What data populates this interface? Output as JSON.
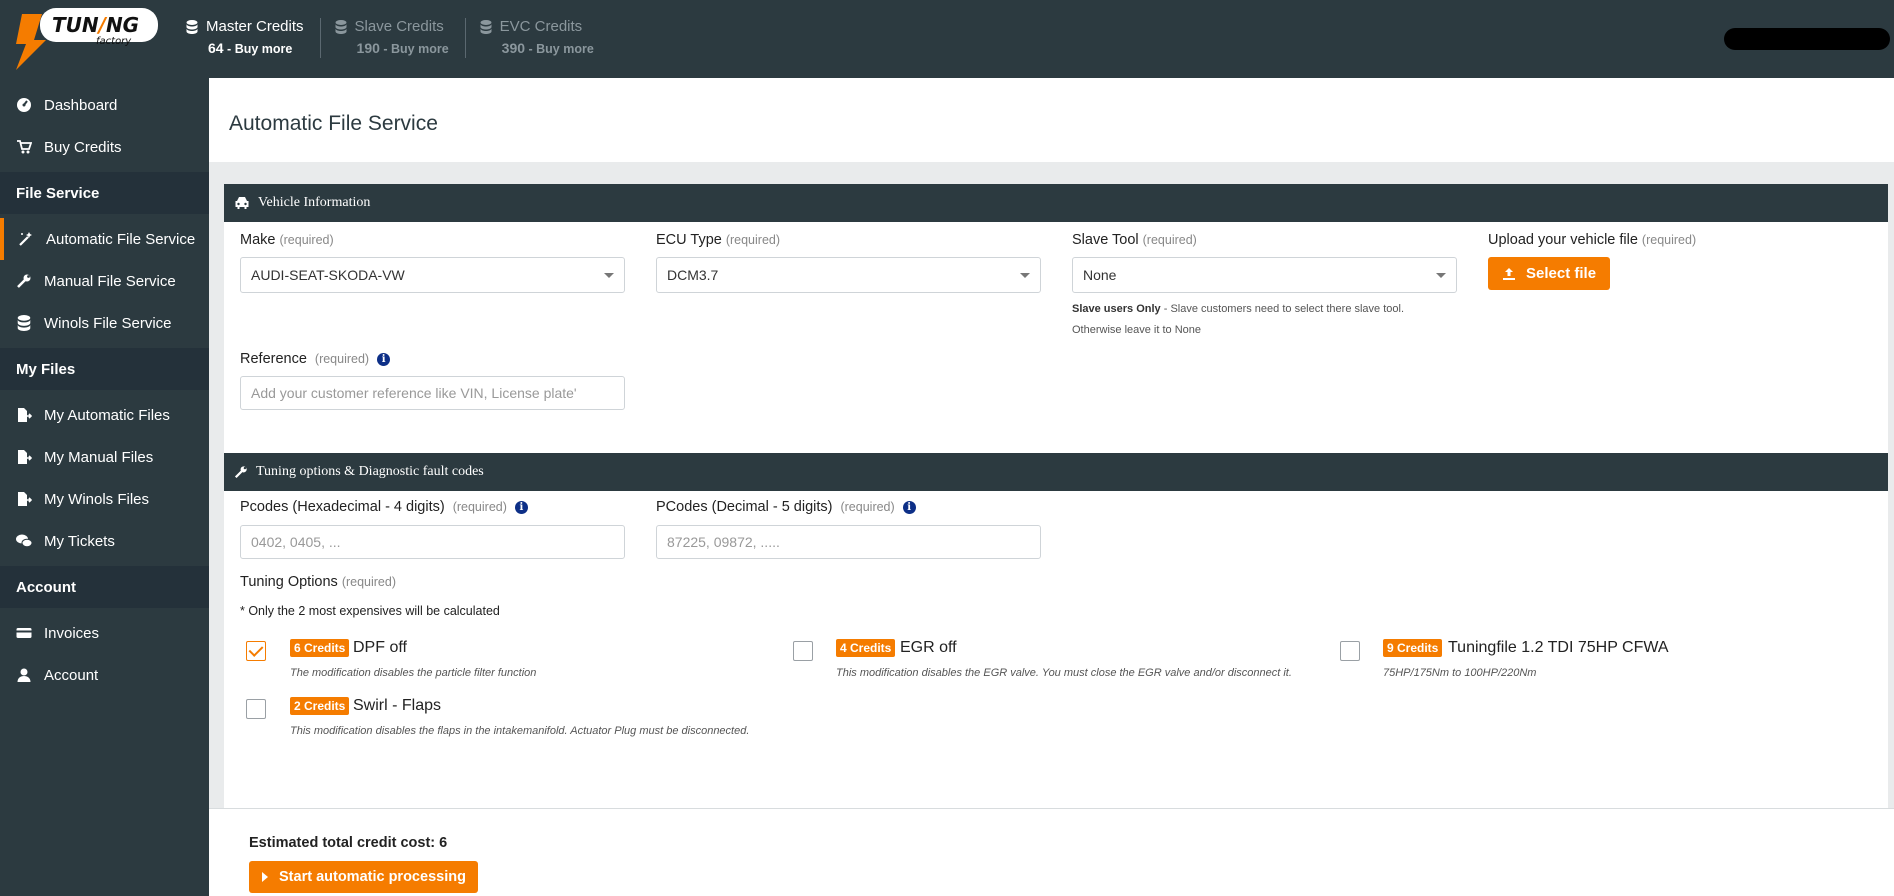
{
  "brand": {
    "logo_text_top": "TUNING",
    "logo_text_bottom": "factory",
    "accent": "#f57c00",
    "dark": "#2c3a40"
  },
  "credits": [
    {
      "title": "Master Credits",
      "amount": "64",
      "link": "Buy more",
      "dim": false
    },
    {
      "title": "Slave Credits",
      "amount": "190",
      "link": "Buy more",
      "dim": true
    },
    {
      "title": "EVC Credits",
      "amount": "390",
      "link": "Buy more",
      "dim": true
    }
  ],
  "sidebar": {
    "top": [
      {
        "label": "Dashboard",
        "icon": "gauge-icon"
      },
      {
        "label": "Buy Credits",
        "icon": "cart-icon"
      }
    ],
    "sections": [
      {
        "title": "File Service",
        "items": [
          {
            "label": "Automatic File Service",
            "icon": "magic-wand-icon",
            "active": true
          },
          {
            "label": "Manual File Service",
            "icon": "wrench-icon"
          },
          {
            "label": "Winols File Service",
            "icon": "database-icon"
          }
        ]
      },
      {
        "title": "My Files",
        "items": [
          {
            "label": "My Automatic Files",
            "icon": "file-export-icon"
          },
          {
            "label": "My Manual Files",
            "icon": "file-export-icon"
          },
          {
            "label": "My Winols Files",
            "icon": "file-export-icon"
          },
          {
            "label": "My Tickets",
            "icon": "comments-icon"
          }
        ]
      },
      {
        "title": "Account",
        "items": [
          {
            "label": "Invoices",
            "icon": "credit-card-icon"
          },
          {
            "label": "Account",
            "icon": "user-icon"
          }
        ]
      }
    ]
  },
  "page": {
    "title": "Automatic File Service"
  },
  "vehicle_panel": {
    "title": "Vehicle Information",
    "required": "(required)",
    "make": {
      "label": "Make",
      "value": "AUDI-SEAT-SKODA-VW"
    },
    "ecu": {
      "label": "ECU Type",
      "value": "DCM3.7"
    },
    "slave_tool": {
      "label": "Slave Tool",
      "value": "None"
    },
    "upload": {
      "label": "Upload your vehicle file",
      "button": "Select file"
    },
    "slave_hint_bold": "Slave users Only",
    "slave_hint_rest": " - Slave customers need to select there slave tool.",
    "slave_hint_line2": "Otherwise leave it to None",
    "reference": {
      "label": "Reference",
      "placeholder": "Add your customer reference like VIN, License plate'"
    }
  },
  "tuning_panel": {
    "title": "Tuning options & Diagnostic fault codes",
    "required": "(required)",
    "pcodes_hex": {
      "label": "Pcodes (Hexadecimal - 4 digits)",
      "placeholder": "0402, 0405, ..."
    },
    "pcodes_dec": {
      "label": "PCodes (Decimal - 5 digits)",
      "placeholder": "87225, 09872, ....."
    },
    "options_label": "Tuning Options",
    "options_note": "* Only the 2 most expensives will be calculated",
    "options": [
      {
        "credits": "6 Credits",
        "name": "DPF off",
        "desc": "The modification disables the particle filter function",
        "checked": true
      },
      {
        "credits": "4 Credits",
        "name": "EGR off",
        "desc": "This modification disables the EGR valve. You must close the EGR valve and/or disconnect it.",
        "checked": false
      },
      {
        "credits": "9 Credits",
        "name": "Tuningfile 1.2 TDI 75HP CFWA",
        "desc": "75HP/175Nm to 100HP/220Nm",
        "checked": false
      },
      {
        "credits": "2 Credits",
        "name": "Swirl - Flaps",
        "desc": "This modification disables the flaps in the intakemanifold. Actuator Plug must be disconnected.",
        "checked": false
      }
    ]
  },
  "footer": {
    "estimate_label": "Estimated total credit cost: 6",
    "start_button": "Start automatic processing"
  }
}
